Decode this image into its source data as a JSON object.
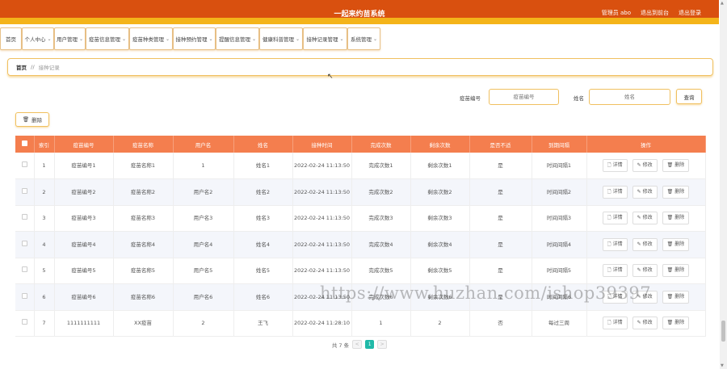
{
  "header": {
    "title": "一起来约苗系统",
    "admin": "管理员 abo",
    "back_to_front": "退出到前台",
    "logout": "退出登录"
  },
  "nav": [
    {
      "label": "首页",
      "dropdown": false
    },
    {
      "label": "个人中心",
      "dropdown": true
    },
    {
      "label": "用户管理",
      "dropdown": true
    },
    {
      "label": "疫苗信息管理",
      "dropdown": true
    },
    {
      "label": "疫苗种类管理",
      "dropdown": true
    },
    {
      "label": "接种预约管理",
      "dropdown": true
    },
    {
      "label": "提醒信息管理",
      "dropdown": true
    },
    {
      "label": "健康科普管理",
      "dropdown": true
    },
    {
      "label": "接种记录管理",
      "dropdown": true
    },
    {
      "label": "系统管理",
      "dropdown": true
    }
  ],
  "breadcrumb": {
    "home": "首页",
    "separator": "//",
    "current": "接种记录"
  },
  "search": {
    "vaccine_label": "疫苗编号",
    "vaccine_placeholder": "疫苗编号",
    "name_label": "姓名",
    "name_placeholder": "姓名",
    "query_button": "查询"
  },
  "batch_delete": "删除",
  "table": {
    "headers": [
      "索引",
      "疫苗编号",
      "疫苗名称",
      "用户名",
      "姓名",
      "接种时间",
      "完成次数",
      "剩余次数",
      "是否不适",
      "到期间隔",
      "操作"
    ],
    "rows": [
      {
        "idx": "1",
        "code": "疫苗编号1",
        "vname": "疫苗名称1",
        "user": "1",
        "name": "姓名1",
        "time": "2022-02-24 11:13:50",
        "done": "完成次数1",
        "left": "剩余次数1",
        "bad": "是",
        "interval": "时间间隔1"
      },
      {
        "idx": "2",
        "code": "疫苗编号2",
        "vname": "疫苗名称2",
        "user": "用户名2",
        "name": "姓名2",
        "time": "2022-02-24 11:13:50",
        "done": "完成次数2",
        "left": "剩余次数2",
        "bad": "是",
        "interval": "时间间隔2"
      },
      {
        "idx": "3",
        "code": "疫苗编号3",
        "vname": "疫苗名称3",
        "user": "用户名3",
        "name": "姓名3",
        "time": "2022-02-24 11:13:50",
        "done": "完成次数3",
        "left": "剩余次数3",
        "bad": "是",
        "interval": "时间间隔3"
      },
      {
        "idx": "4",
        "code": "疫苗编号4",
        "vname": "疫苗名称4",
        "user": "用户名4",
        "name": "姓名4",
        "time": "2022-02-24 11:13:50",
        "done": "完成次数4",
        "left": "剩余次数4",
        "bad": "是",
        "interval": "时间间隔4"
      },
      {
        "idx": "5",
        "code": "疫苗编号5",
        "vname": "疫苗名称5",
        "user": "用户名5",
        "name": "姓名5",
        "time": "2022-02-24 11:13:50",
        "done": "完成次数5",
        "left": "剩余次数5",
        "bad": "是",
        "interval": "时间间隔5"
      },
      {
        "idx": "6",
        "code": "疫苗编号6",
        "vname": "疫苗名称6",
        "user": "用户名6",
        "name": "姓名6",
        "time": "2022-02-24 11:13:50",
        "done": "完成次数6",
        "left": "剩余次数6",
        "bad": "是",
        "interval": "时间间隔6"
      },
      {
        "idx": "7",
        "code": "1111111111",
        "vname": "XX疫苗",
        "user": "2",
        "name": "王飞",
        "time": "2022-02-24 11:28:10",
        "done": "1",
        "left": "2",
        "bad": "否",
        "interval": "每过三周"
      }
    ],
    "ops": {
      "detail": "详情",
      "edit": "修改",
      "delete": "删除"
    }
  },
  "pagination": {
    "total": "共 7 条",
    "current_page": "1"
  },
  "watermark": "https://www.huzhan.com/ishop39397",
  "icons": {
    "detail": "doc-icon",
    "edit": "pencil-icon",
    "delete": "trash-icon"
  },
  "colors": {
    "header": "#d9500f",
    "accent": "#f4b41a",
    "table_header": "#f47e4e",
    "page_active": "#20b9a8"
  }
}
